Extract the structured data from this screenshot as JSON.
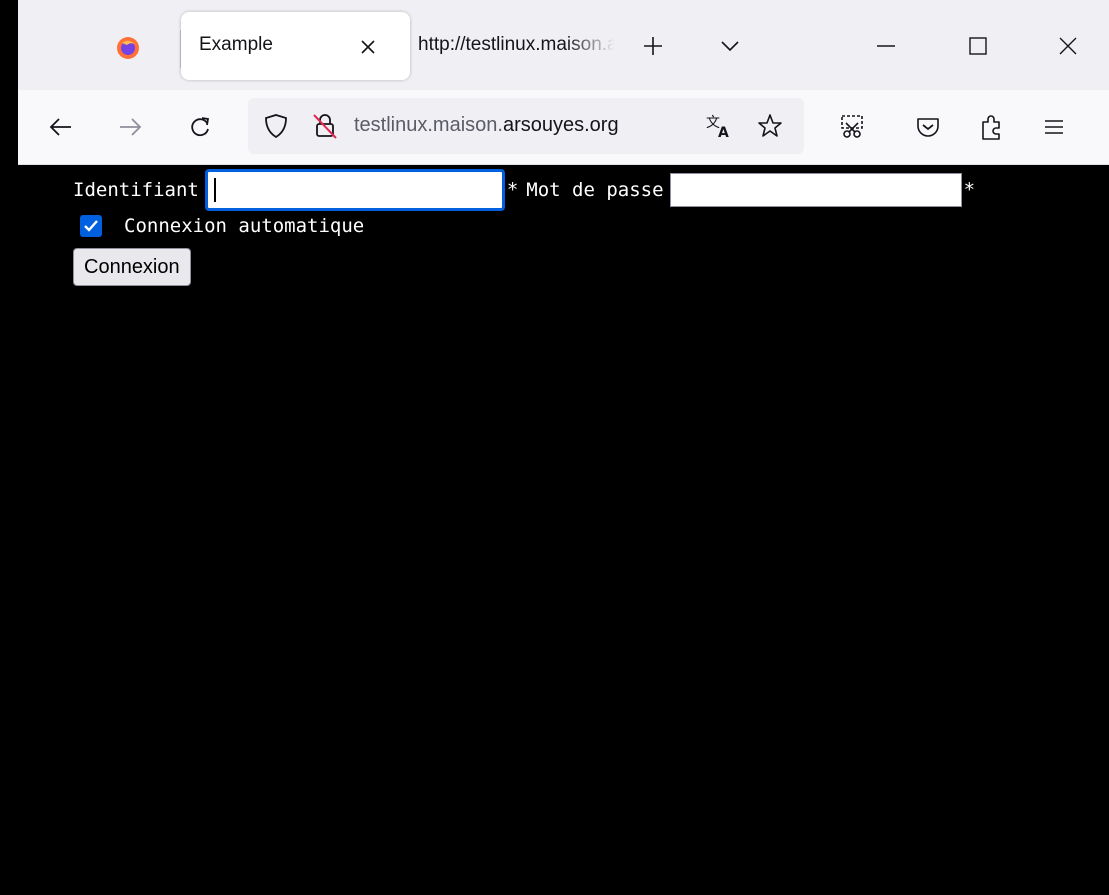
{
  "browser": {
    "tabs": [
      {
        "title": "Example",
        "active": true
      },
      {
        "title": "http://testlinux.maison.arsouyes.org",
        "active": false
      }
    ],
    "url": {
      "prefix": "testlinux.maison.",
      "domain": "arsouyes.org"
    },
    "colors": {
      "accent": "#0060df",
      "tabbar": "#f0f0f4",
      "toolbar": "#f9f9fb"
    }
  },
  "form": {
    "username_label": "Identifiant",
    "username_value": "",
    "required_mark": "*",
    "password_label": "Mot de passe",
    "password_value": "",
    "remember_label": "Connexion automatique",
    "remember_checked": true,
    "submit_label": "Connexion"
  },
  "icons": [
    "firefox-icon",
    "close-icon",
    "plus-icon",
    "chevron-down-icon",
    "minimize-icon",
    "maximize-icon",
    "back-icon",
    "forward-icon",
    "reload-icon",
    "shield-icon",
    "insecure-lock-icon",
    "translate-icon",
    "star-icon",
    "screenshot-icon",
    "pocket-icon",
    "extensions-icon",
    "menu-icon"
  ]
}
